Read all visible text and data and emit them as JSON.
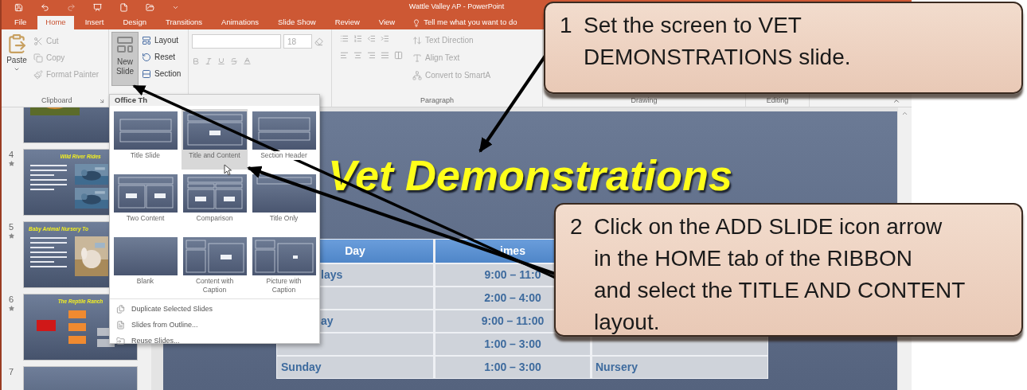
{
  "window": {
    "title": "Wattle Valley AP - PowerPoint"
  },
  "tabs": [
    {
      "label": "File",
      "selected": false
    },
    {
      "label": "Home",
      "selected": true
    },
    {
      "label": "Insert",
      "selected": false
    },
    {
      "label": "Design",
      "selected": false
    },
    {
      "label": "Transitions",
      "selected": false
    },
    {
      "label": "Animations",
      "selected": false
    },
    {
      "label": "Slide Show",
      "selected": false
    },
    {
      "label": "Review",
      "selected": false
    },
    {
      "label": "View",
      "selected": false
    }
  ],
  "tell_me": "Tell me what you want to do",
  "ribbon": {
    "clipboard": {
      "paste": "Paste",
      "items": [
        {
          "label": "Cut",
          "disabled": true
        },
        {
          "label": "Copy",
          "disabled": true
        },
        {
          "label": "Format Painter",
          "disabled": true
        }
      ],
      "label": "Clipboard"
    },
    "slides": {
      "new_slide": {
        "label": "New Slide",
        "pressed": true
      },
      "items": [
        {
          "label": "Layout",
          "disabled": false
        },
        {
          "label": "Reset",
          "disabled": false
        },
        {
          "label": "Section",
          "disabled": false
        }
      ]
    },
    "font": {
      "size": "18"
    },
    "paragraph": {
      "items": [
        {
          "label": "Text Direction",
          "disabled": true
        },
        {
          "label": "Align Text",
          "disabled": true
        },
        {
          "label": "Convert to SmartA",
          "disabled": true
        }
      ],
      "label": "Paragraph"
    },
    "drawing": {
      "label": "Drawing"
    },
    "editing": {
      "label": "Editing"
    }
  },
  "thumbnails": [
    {
      "kind": "photo-left"
    },
    {
      "number": "4",
      "animated": true,
      "title": "Wild River Rides",
      "kind": "text-photos"
    },
    {
      "number": "5",
      "animated": true,
      "title": "Baby Animal Nursery To",
      "kind": "text-photo"
    },
    {
      "number": "6",
      "animated": true,
      "title": "The Reptile Ranch",
      "kind": "diagram"
    },
    {
      "number": "7",
      "kind": "plain"
    }
  ],
  "slide": {
    "title": "Vet Demonstrations",
    "table": {
      "columns": [
        "Day",
        "imes"
      ],
      "rows": [
        {
          "day": "lays",
          "day_cut": true,
          "times": "9:00 – 11:0"
        },
        {
          "times": "2:00 – 4:00"
        },
        {
          "day": "ay",
          "day_cut": true,
          "times": "9:00 – 11:00"
        },
        {
          "times": "1:00 – 3:00"
        },
        {
          "day": "Sunday",
          "day_cut": false,
          "times": "1:00 – 3:00",
          "column_3": "Nursery"
        }
      ]
    }
  },
  "new_slide_menu": {
    "header": "Office Th",
    "layouts": [
      {
        "label": "Title Slide",
        "kind": "title",
        "selected": false
      },
      {
        "label": "Title and Content",
        "kind": "title-content",
        "selected": true
      },
      {
        "label": "Section Header",
        "kind": "section",
        "selected": false
      },
      {
        "label": "Two Content",
        "kind": "two-content",
        "selected": false
      },
      {
        "label": "Comparison",
        "kind": "comparison",
        "selected": false
      },
      {
        "label": "Title Only",
        "kind": "title-only",
        "selected": false
      },
      {
        "label": "Blank",
        "kind": "blank",
        "selected": false
      },
      {
        "label": "Content with Caption",
        "kind": "content-caption",
        "selected": false
      },
      {
        "label": "Picture with Caption",
        "kind": "picture-caption",
        "selected": false
      }
    ],
    "commands": [
      "Duplicate Selected Slides",
      "Slides from Outline...",
      "Reuse Slides..."
    ]
  },
  "callouts": [
    {
      "number": "1",
      "lines": [
        "Set the screen to VET",
        "DEMONSTRATIONS slide."
      ]
    },
    {
      "number": "2",
      "lines": [
        "Click on the ADD SLIDE icon arrow",
        "in the HOME tab of the RIBBON",
        "and select the TITLE AND CONTENT",
        "layout."
      ]
    }
  ]
}
